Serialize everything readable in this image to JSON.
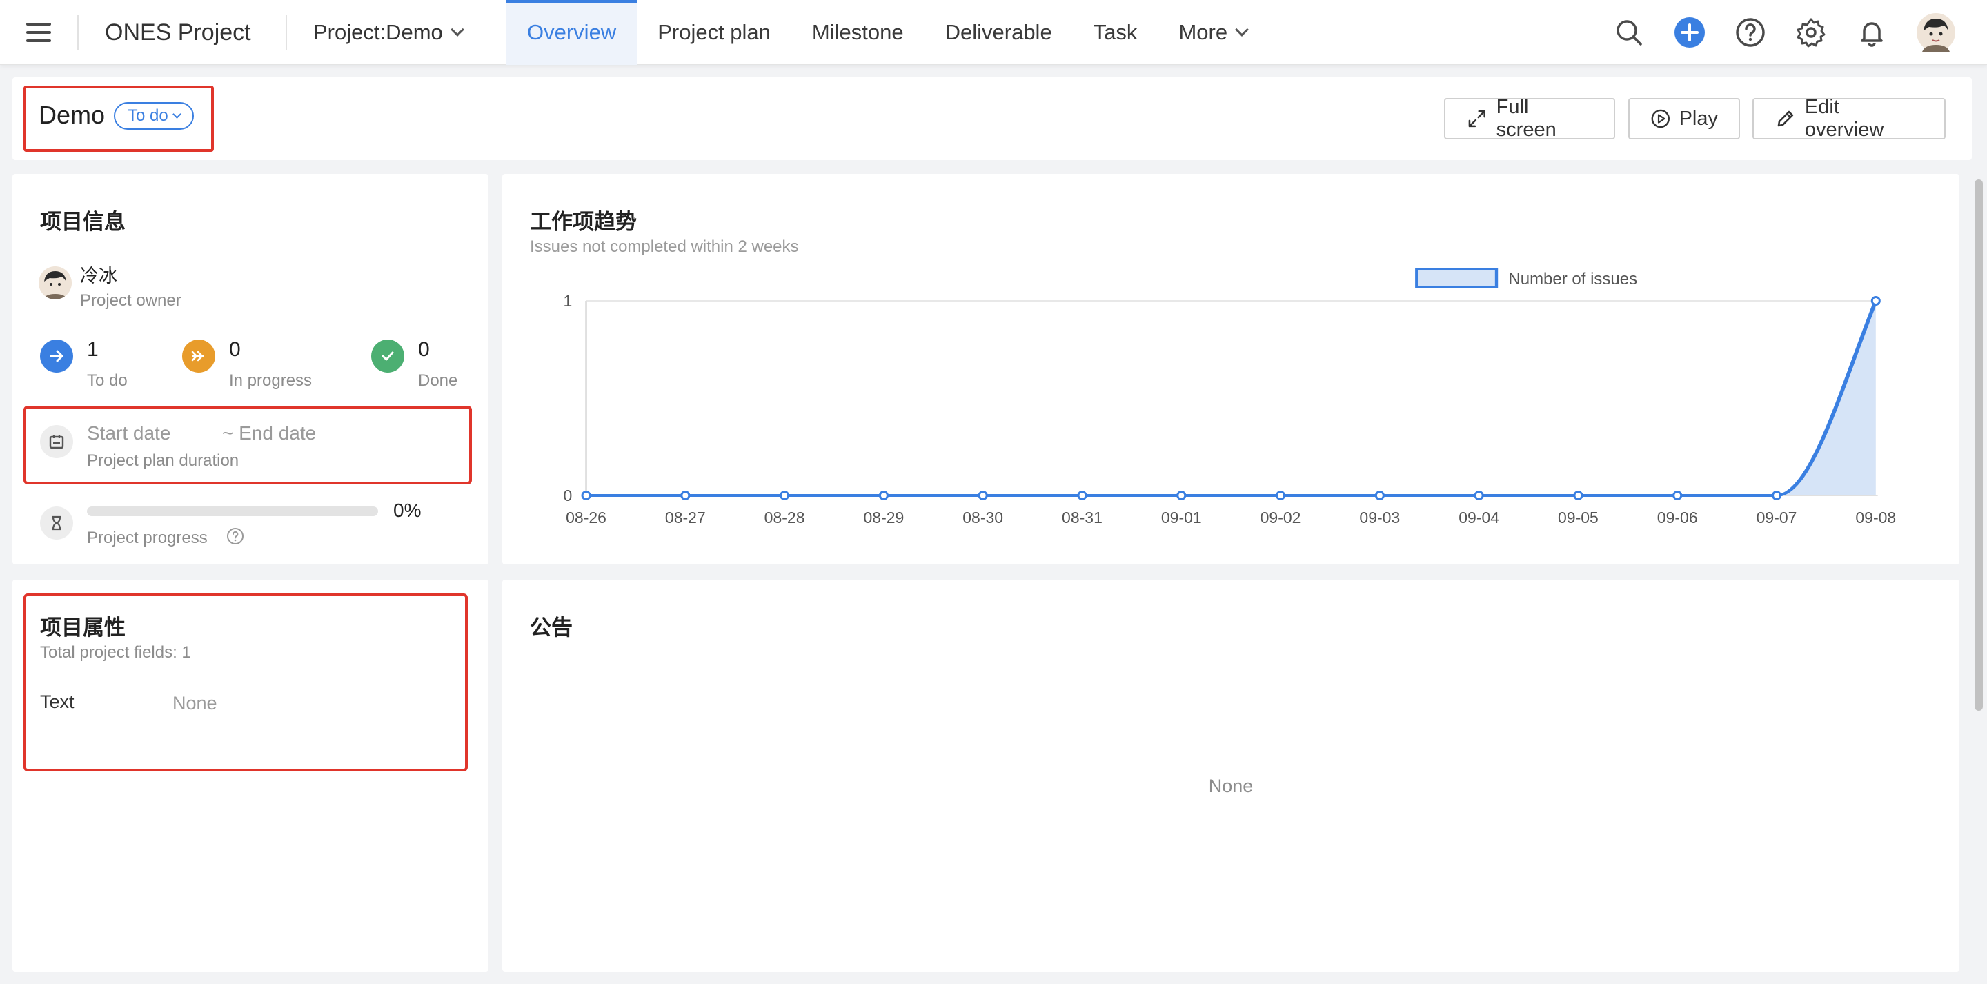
{
  "nav": {
    "app_title": "ONES Project",
    "project_select": "Project:Demo",
    "tabs": [
      {
        "label": "Overview",
        "active": true
      },
      {
        "label": "Project plan"
      },
      {
        "label": "Milestone"
      },
      {
        "label": "Deliverable"
      },
      {
        "label": "Task"
      }
    ],
    "more_label": "More",
    "icons": [
      "search-icon",
      "add-icon",
      "help-icon",
      "settings-icon",
      "notification-icon",
      "user-avatar"
    ]
  },
  "header": {
    "project_name": "Demo",
    "status": "To do",
    "buttons": {
      "full_screen": "Full screen",
      "play": "Play",
      "edit_overview": "Edit overview"
    }
  },
  "project_info": {
    "title": "项目信息",
    "owner_name": "冷冰",
    "owner_label": "Project owner",
    "stats": [
      {
        "value": "1",
        "label": "To do",
        "color": "#3a7fe1"
      },
      {
        "value": "0",
        "label": "In progress",
        "color": "#e89c2b"
      },
      {
        "value": "0",
        "label": "Done",
        "color": "#4caf72"
      }
    ],
    "start_date_placeholder": "Start date",
    "end_date_placeholder": "~ End date",
    "duration_label": "Project plan duration",
    "progress_value": "0%",
    "progress_label": "Project progress"
  },
  "project_attrs": {
    "title": "项目属性",
    "subtitle": "Total project fields: 1",
    "fields": [
      {
        "name": "Text",
        "value": "None"
      }
    ]
  },
  "announcement": {
    "title": "公告",
    "empty_text": "None"
  },
  "trend": {
    "title": "工作项趋势",
    "subtitle": "Issues not completed within 2 weeks"
  },
  "chart_data": {
    "type": "area",
    "title": "工作项趋势",
    "subtitle": "Issues not completed within 2 weeks",
    "categories": [
      "08-26",
      "08-27",
      "08-28",
      "08-29",
      "08-30",
      "08-31",
      "09-01",
      "09-02",
      "09-03",
      "09-04",
      "09-05",
      "09-06",
      "09-07",
      "09-08"
    ],
    "series": [
      {
        "name": "Number of issues",
        "values": [
          0,
          0,
          0,
          0,
          0,
          0,
          0,
          0,
          0,
          0,
          0,
          0,
          0,
          1
        ],
        "color": "#3a7fe1"
      }
    ],
    "ylim": [
      0,
      1
    ],
    "yticks": [
      "0",
      "1"
    ],
    "legend": "top-center",
    "grid": true
  },
  "colors": {
    "accent": "#3a7fe1",
    "highlight_border": "#e0352b"
  }
}
